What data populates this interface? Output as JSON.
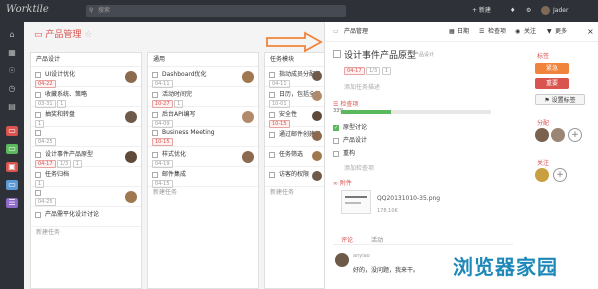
{
  "app": {
    "logo": "Worktile",
    "search_placeholder": "搜索",
    "new_label": "+ 新建",
    "user": "Jader"
  },
  "project": {
    "title": "产品管理"
  },
  "columns": [
    {
      "title": "产品设计",
      "tasks": [
        {
          "title": "UI设计优化",
          "date": "04-22",
          "date_red": true,
          "sub": "",
          "att": ""
        },
        {
          "title": "收藏系统、策略",
          "date": "03-31",
          "date_red": false,
          "sub": "1",
          "att": ""
        },
        {
          "title": "抽奖和转盘",
          "date": "",
          "date_red": false,
          "sub": "1",
          "att": ""
        },
        {
          "title": "",
          "date": "04-25",
          "date_red": false,
          "sub": "",
          "att": ""
        },
        {
          "title": "设计事件产品原型",
          "date": "04-17",
          "date_red": true,
          "sub": "1/3",
          "att": "1"
        },
        {
          "title": "任务归档",
          "date": "",
          "date_red": false,
          "sub": "1",
          "att": ""
        },
        {
          "title": "",
          "date": "04-25",
          "date_red": false,
          "sub": "",
          "att": ""
        },
        {
          "title": "产品需平化设计讨论",
          "date": "",
          "date_red": false,
          "sub": "",
          "att": ""
        }
      ],
      "new": "新建任务"
    },
    {
      "title": "通用",
      "tasks": [
        {
          "title": "Dashboard优化",
          "date": "04-11",
          "date_red": false,
          "sub": "",
          "att": ""
        },
        {
          "title": "活动时间完",
          "date": "10-27",
          "date_red": true,
          "sub": "1",
          "att": ""
        },
        {
          "title": "后台API编写",
          "date": "04-09",
          "date_red": false,
          "sub": "",
          "att": ""
        },
        {
          "title": "Business Meeting",
          "date": "10-15",
          "date_red": true,
          "sub": "",
          "att": ""
        },
        {
          "title": "样式优化",
          "date": "04-19",
          "date_red": false,
          "sub": "",
          "att": ""
        },
        {
          "title": "邮件集成",
          "date": "04-15",
          "date_red": false,
          "sub": "",
          "att": ""
        }
      ],
      "new": "新建任务"
    },
    {
      "title": "任务模块",
      "tasks": [
        {
          "title": "指动成员分配任务",
          "date": "04-11",
          "date_red": false,
          "sub": "",
          "att": ""
        },
        {
          "title": "日历，包括全部日历，任务在日历的",
          "date": "10-01",
          "date_red": false,
          "sub": "",
          "att": ""
        },
        {
          "title": "安全性",
          "date": "10-15",
          "date_red": true,
          "sub": "",
          "att": ""
        },
        {
          "title": "通过邮件创建任务",
          "date": "",
          "date_red": false,
          "sub": "",
          "att": ""
        },
        {
          "title": "任务筛选",
          "date": "",
          "date_red": false,
          "sub": "",
          "att": ""
        },
        {
          "title": "访客的权限",
          "date": "",
          "date_red": false,
          "sub": "",
          "att": ""
        }
      ],
      "new": "新建任务"
    }
  ],
  "detail": {
    "crumb": "产品管理",
    "actions": {
      "calendar": "日期",
      "check": "检查项",
      "watch": "关注",
      "more": "更多"
    },
    "title": "设计事件产品原型",
    "project": "产品设计",
    "date": "04-17",
    "sub": "1/3",
    "att": "1",
    "add_desc": "添加任务描述",
    "checklist_label": "检查项",
    "progress_text": "33%",
    "progress": 0.33,
    "checks": [
      {
        "text": "原型讨论",
        "done": true
      },
      {
        "text": "产品设计",
        "done": false
      },
      {
        "text": "重构",
        "done": false
      }
    ],
    "add_check": "添加检查项",
    "att_label": "附件",
    "file_name": "QQ20131010-35.png",
    "file_size": "178.10K",
    "tabs": [
      "评论",
      "活动"
    ],
    "comment_user": "anyiao",
    "comment_text": "好的，没问题，我来干。"
  },
  "side": {
    "tag_label": "标签",
    "tags": [
      {
        "name": "紧急",
        "color": "#f0843c"
      },
      {
        "name": "重要",
        "color": "#d9534f"
      }
    ],
    "set_tag": "设置标签",
    "assign_label": "分配",
    "watch_label": "关注"
  },
  "watermark": "浏览器家园"
}
